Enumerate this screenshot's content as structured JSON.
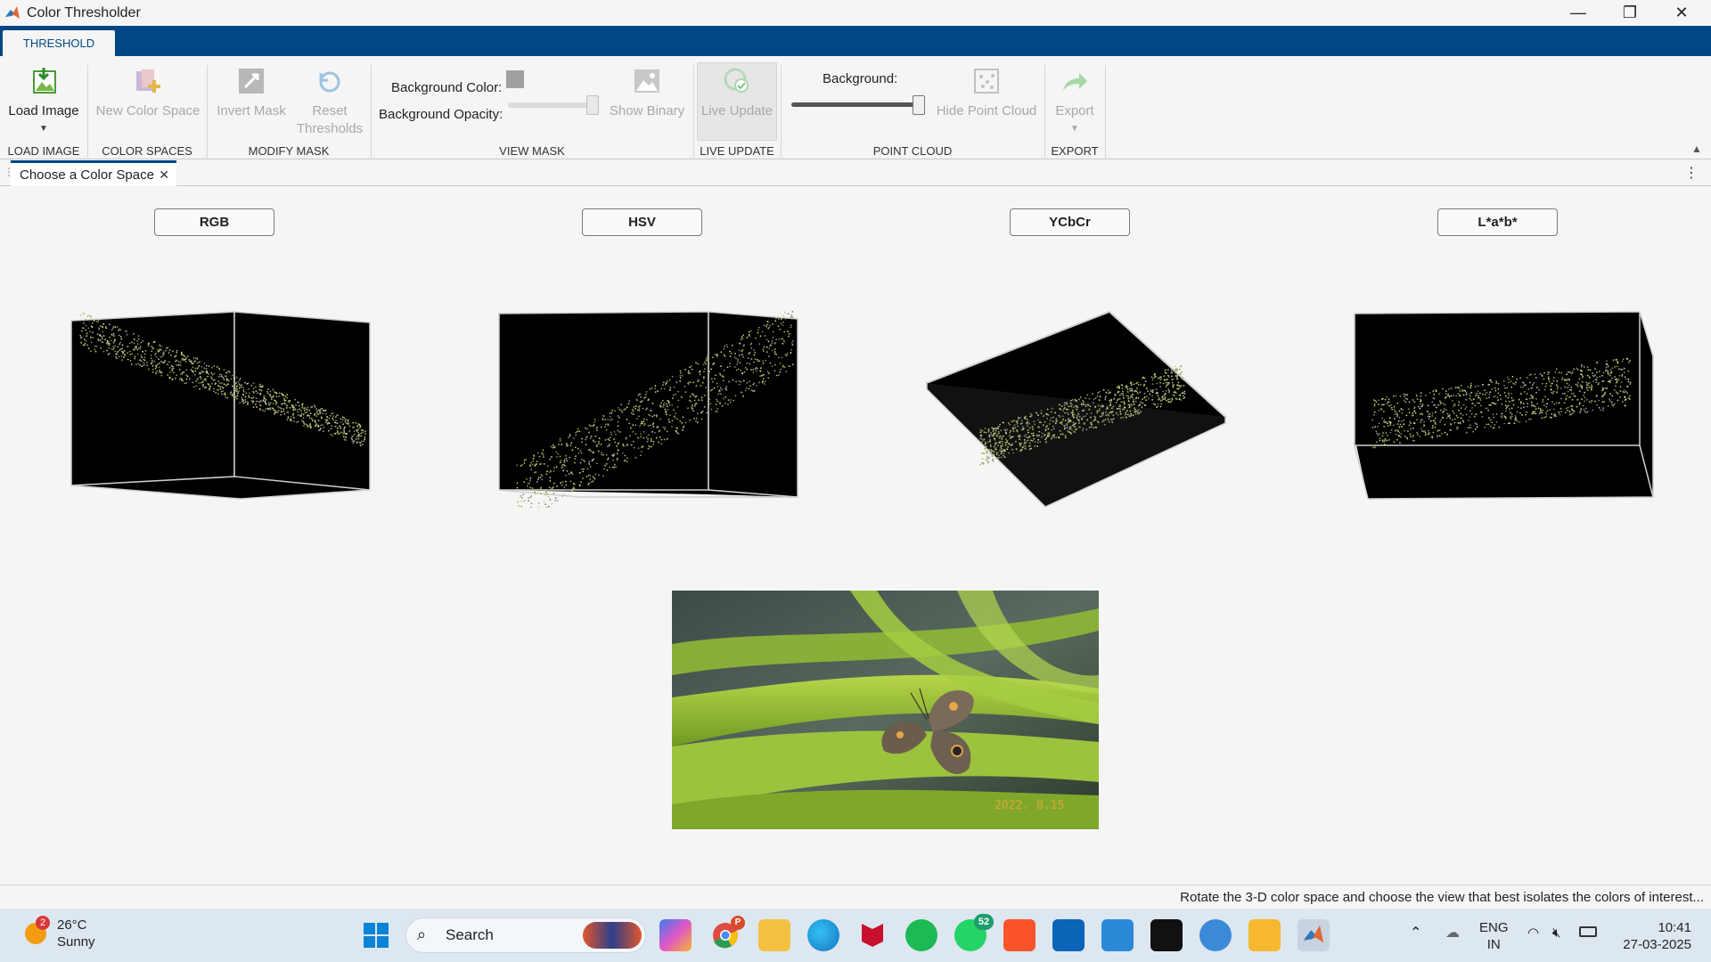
{
  "window": {
    "title": "Color Thresholder",
    "minimize": "—",
    "restore": "❐",
    "close": "✕"
  },
  "ribbon_tab": "THRESHOLD",
  "buttons": {
    "load_image": "Load Image",
    "new_color_space": "New Color Space",
    "invert_mask": "Invert Mask",
    "reset_thresholds_1": "Reset",
    "reset_thresholds_2": "Thresholds",
    "background_color": "Background Color:",
    "background_opacity": "Background Opacity:",
    "show_binary": "Show Binary",
    "live_update": "Live Update",
    "background": "Background:",
    "hide_point_cloud": "Hide Point Cloud",
    "export": "Export"
  },
  "groups": {
    "load_image": "LOAD IMAGE",
    "color_spaces": "COLOR SPACES",
    "modify_mask": "MODIFY MASK",
    "view_mask": "VIEW MASK",
    "live_update": "LIVE UPDATE",
    "point_cloud": "POINT CLOUD",
    "export": "EXPORT"
  },
  "document_tab": "Choose a Color Space",
  "color_spaces": [
    "RGB",
    "HSV",
    "YCbCr",
    "L*a*b*"
  ],
  "image_date_stamp": "2022. 8.15",
  "status_message": "Rotate the 3-D color space and choose the view that best isolates the colors of interest...",
  "taskbar": {
    "weather_temp": "26°C",
    "weather_desc": "Sunny",
    "weather_badge": "2",
    "search_label": "Search",
    "chrome_badge": "P",
    "whatsapp_badge": "52",
    "lang_1": "ENG",
    "lang_2": "IN",
    "time": "10:41",
    "date": "27-03-2025"
  },
  "colors": {
    "accent": "#004785",
    "background": "#f5f5f5",
    "disabled": "#a8a8a8"
  }
}
